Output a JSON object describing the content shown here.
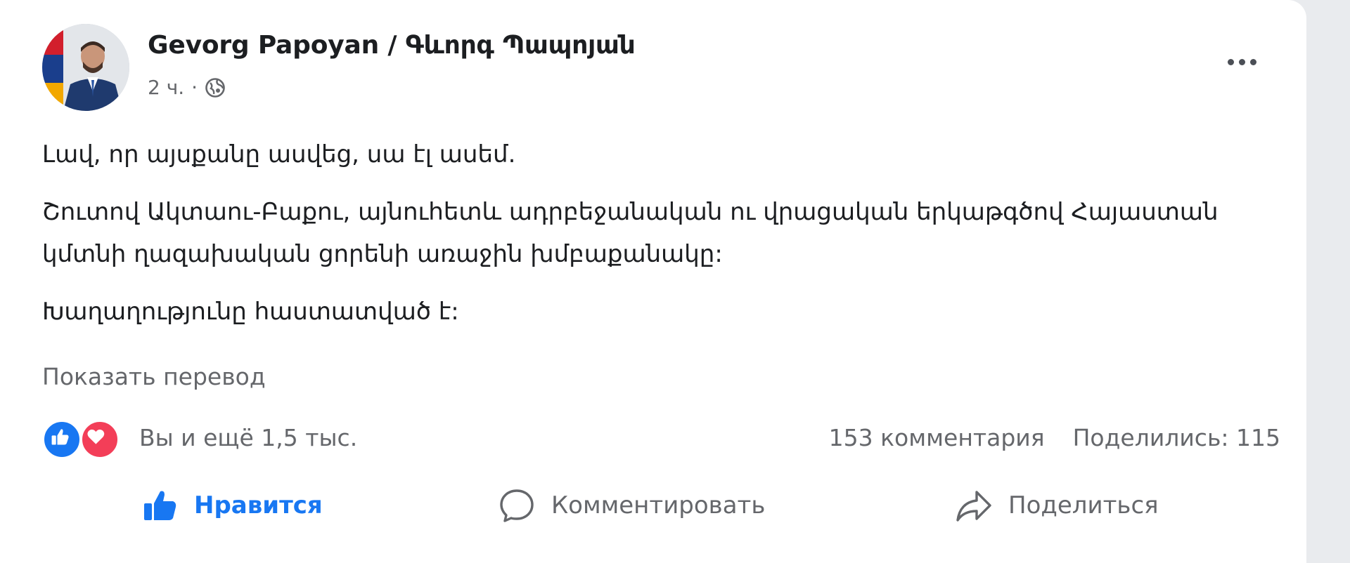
{
  "post": {
    "author": "Gevorg Papoyan / Գևորգ Պապոյան",
    "time": "2 ч.",
    "separator": "·",
    "paragraphs": [
      "Լավ, որ այսքանը ասվեց, սա էլ ասեմ.",
      "Շուտով Ակտաու-Բաքու, այնուհետև ադրբեջանական ու վրացական երկաթգծով Հայաստան կմտնի ղազախական ցորենի առաջին խմբաքանակը:",
      "Խաղաղությունը հաստատված է:"
    ],
    "translate_label": "Показать перевод"
  },
  "reactions": {
    "summary": "Вы и ещё 1,5 тыс.",
    "types": [
      "like",
      "love"
    ]
  },
  "stats": {
    "comments": "153 комментария",
    "shares": "Поделились: 115"
  },
  "actions": {
    "like": "Нравится",
    "comment": "Комментировать",
    "share": "Поделиться"
  },
  "colors": {
    "accent": "#1877f2",
    "love": "#f33e58",
    "muted": "#65676b",
    "text": "#1c1e21"
  }
}
